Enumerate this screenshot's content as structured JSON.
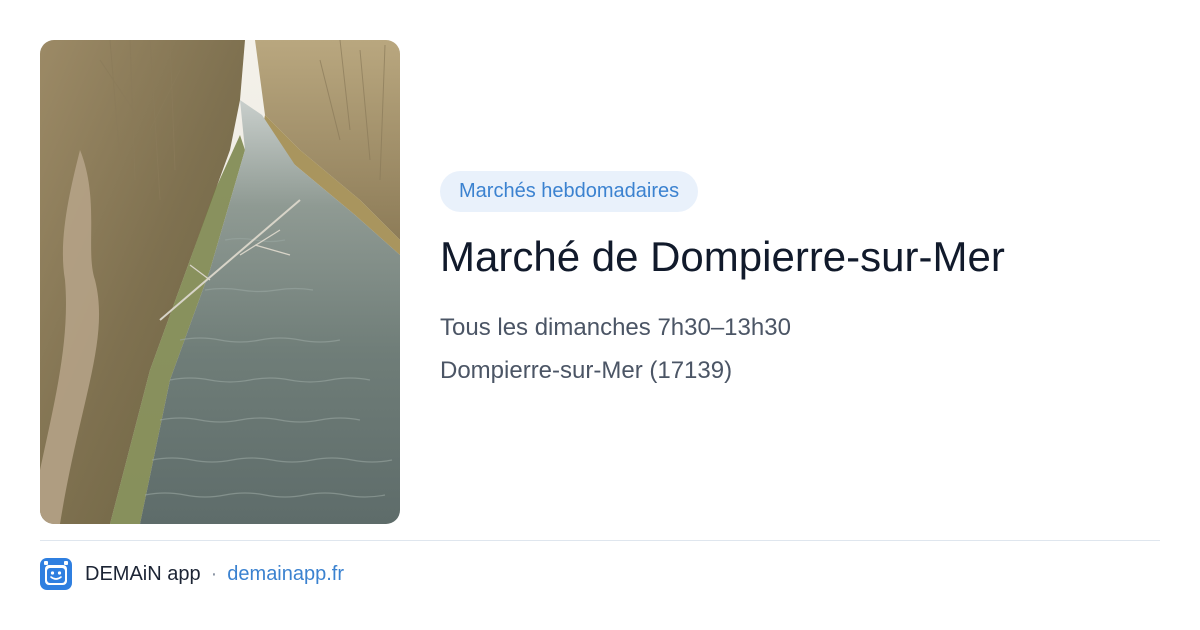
{
  "card": {
    "category": "Marchés hebdomadaires",
    "title": "Marché de Dompierre-sur-Mer",
    "schedule": "Tous les dimanches 7h30–13h30",
    "location": "Dompierre-sur-Mer (17139)",
    "photo_subject": "canal with grassy banks and bare trees"
  },
  "footer": {
    "app_name": "DEMAiN app",
    "separator": "·",
    "domain": "demainapp.fr",
    "app_icon": "demain-app-icon"
  },
  "colors": {
    "accent": "#3b82d0",
    "chip_background": "#e9f1fb",
    "title": "#111a2b",
    "secondary_text": "#4b5565",
    "divider": "#dfe6ee"
  }
}
